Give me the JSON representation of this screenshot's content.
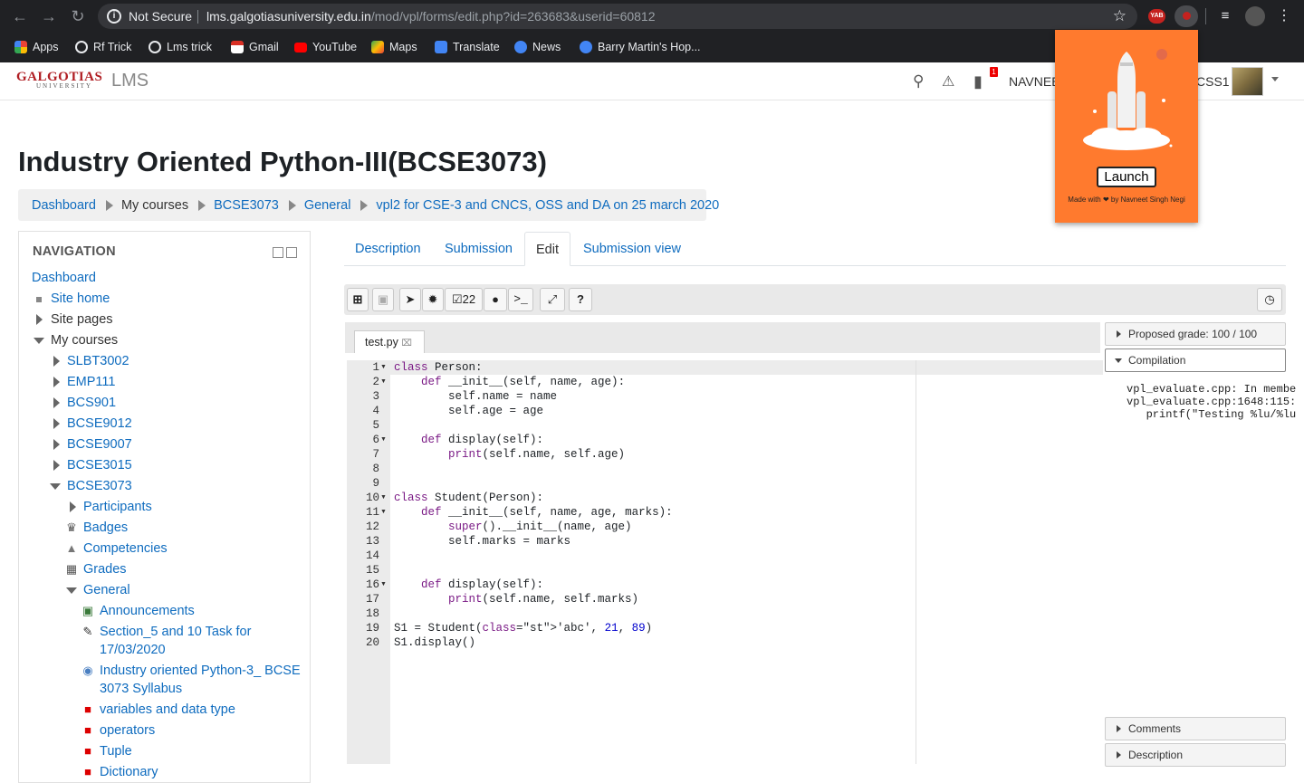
{
  "browser": {
    "security_label": "Not Secure",
    "url_host": "lms.galgotiasuniversity.edu.in",
    "url_path": "/mod/vpl/forms/edit.php?id=263683&userid=60812",
    "bookmarks": [
      {
        "label": "Apps",
        "icon": "apps-grid-icon",
        "color": "#4285f4"
      },
      {
        "label": "Rf Trick",
        "icon": "globe-icon",
        "color": "#e8eaed"
      },
      {
        "label": "Lms trick",
        "icon": "globe-icon",
        "color": "#e8eaed"
      },
      {
        "label": "Gmail",
        "icon": "gmail-icon",
        "color": "#d93025"
      },
      {
        "label": "YouTube",
        "icon": "youtube-icon",
        "color": "#ff0000"
      },
      {
        "label": "Maps",
        "icon": "maps-icon",
        "color": "#34a853"
      },
      {
        "label": "Translate",
        "icon": "translate-icon",
        "color": "#4285f4"
      },
      {
        "label": "News",
        "icon": "news-icon",
        "color": "#4285f4"
      },
      {
        "label": "Barry Martin's Hop...",
        "icon": "bookmark-icon",
        "color": "#4285f4"
      }
    ],
    "ext_badge": "YAB"
  },
  "header": {
    "app_name": "LMS",
    "logo_text": "GALGOTIAS",
    "logo_sub": "UNIVERSITY",
    "notif_count": "1",
    "user_left": "NAVNEE",
    "user_right": "CSS1"
  },
  "popup": {
    "launch_label": "Launch",
    "made_with": "Made with ❤ by Navneet Singh Negi"
  },
  "page": {
    "title": "Industry Oriented Python-III(BCSE3073)",
    "breadcrumb": [
      "Dashboard",
      "My courses",
      "BCSE3073",
      "General",
      "vpl2 for CSE-3 and CNCS, OSS and DA on 25 march 2020"
    ]
  },
  "navigation": {
    "heading": "NAVIGATION",
    "items": [
      "Dashboard",
      "Site home",
      "Site pages",
      "My courses",
      "SLBT3002",
      "EMP111",
      "BCS901",
      "BCSE9012",
      "BCSE9007",
      "BCSE3015",
      "BCSE3073",
      "Participants",
      "Badges",
      "Competencies",
      "Grades",
      "General",
      "Announcements",
      "Section_5 and 10 Task for",
      "17/03/2020",
      "Industry oriented Python-3_ BCSE",
      "3073 Syllabus",
      "variables and data type",
      "operators",
      "Tuple",
      "Dictionary"
    ]
  },
  "tabs": [
    "Description",
    "Submission",
    "Edit",
    "Submission view"
  ],
  "toolbar": {
    "evaluate_count": "22"
  },
  "editor": {
    "file_tab": "test.py",
    "lines": [
      "class Person:",
      "    def __init__(self, name, age):",
      "        self.name = name",
      "        self.age = age",
      "",
      "    def display(self):",
      "        print(self.name, self.age)",
      "",
      "",
      "class Student(Person):",
      "    def __init__(self, name, age, marks):",
      "        super().__init__(name, age)",
      "        self.marks = marks",
      "",
      "",
      "    def display(self):",
      "        print(self.name, self.marks)",
      "",
      "S1 = Student('abc', 21, 89)",
      "S1.display()"
    ],
    "line_numbers": [
      "1",
      "2",
      "3",
      "4",
      "5",
      "6",
      "7",
      "8",
      "9",
      "10",
      "11",
      "12",
      "13",
      "14",
      "15",
      "16",
      "17",
      "18",
      "19",
      "20"
    ]
  },
  "right_panel": {
    "grade": "Proposed grade: 100 / 100",
    "compilation": "Compilation",
    "compilation_output": "vpl_evaluate.cpp: In membe\nvpl_evaluate.cpp:1648:115:\n   printf(\"Testing %lu/%lu",
    "comments": "Comments",
    "description": "Description"
  }
}
